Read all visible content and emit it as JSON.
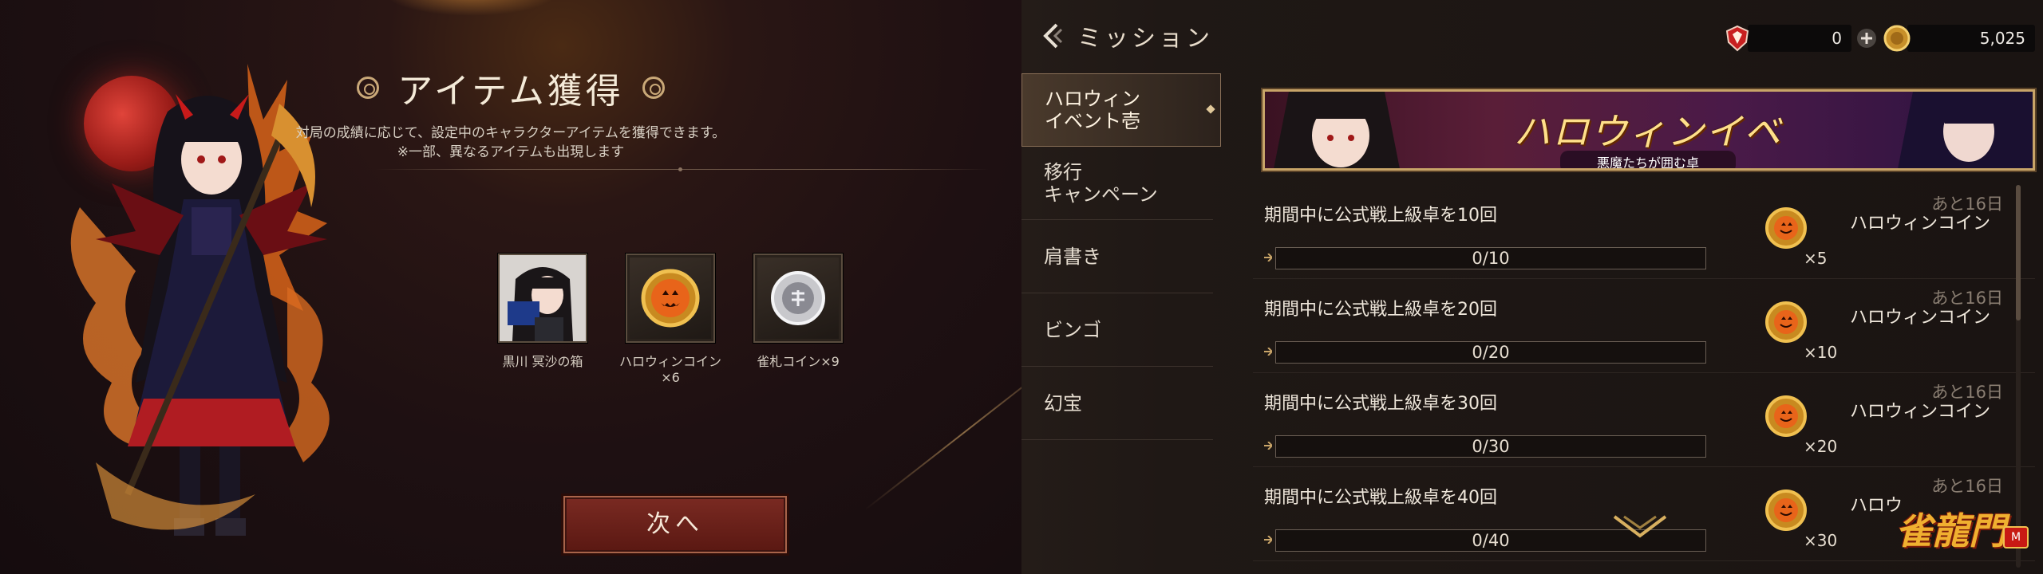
{
  "left": {
    "title": "アイテム獲得",
    "description_line1": "対局の成績に応じて、設定中のキャラクターアイテムを獲得できます。",
    "description_line2": "※一部、異なるアイテムも出現します",
    "items": [
      {
        "label": "黒川 冥沙の箱",
        "icon": "character-box-icon"
      },
      {
        "label": "ハロウィンコイン×6",
        "icon": "pumpkin-coin-icon"
      },
      {
        "label": "雀札コイン×9",
        "icon": "silver-coin-icon"
      }
    ],
    "next_button": "次へ"
  },
  "right": {
    "page_title": "ミッション",
    "currency": {
      "gems": "0",
      "coins": "5,025"
    },
    "sidebar": [
      {
        "label_line1": "ハロウィン",
        "label_line2": "イベント壱",
        "active": true
      },
      {
        "label_line1": "移行",
        "label_line2": "キャンペーン",
        "active": false
      },
      {
        "label_line1": "肩書き",
        "label_line2": "",
        "active": false
      },
      {
        "label_line1": "ビンゴ",
        "label_line2": "",
        "active": false
      },
      {
        "label_line1": "幻宝",
        "label_line2": "",
        "active": false
      }
    ],
    "banner": {
      "title": "ハロウィンイベント",
      "subtitle": "悪魔たちが囲む卓"
    },
    "missions": [
      {
        "text": "期間中に公式戦上級卓を10回",
        "remaining": "あと16日",
        "progress": "0/10",
        "reward_qty": "×5",
        "reward_name": "ハロウィンコイン"
      },
      {
        "text": "期間中に公式戦上級卓を20回",
        "remaining": "あと16日",
        "progress": "0/20",
        "reward_qty": "×10",
        "reward_name": "ハロウィンコイン"
      },
      {
        "text": "期間中に公式戦上級卓を30回",
        "remaining": "あと16日",
        "progress": "0/30",
        "reward_qty": "×20",
        "reward_name": "ハロウィンコイン"
      },
      {
        "text": "期間中に公式戦上級卓を40回",
        "remaining": "あと16日",
        "progress": "0/40",
        "reward_qty": "×30",
        "reward_name": "ハロウ"
      }
    ],
    "logo": "雀龍門",
    "logo_badge": "M"
  },
  "colors": {
    "accent_gold": "#c9a878",
    "button_red": "#7a2a22",
    "coin_orange": "#e08a20"
  }
}
